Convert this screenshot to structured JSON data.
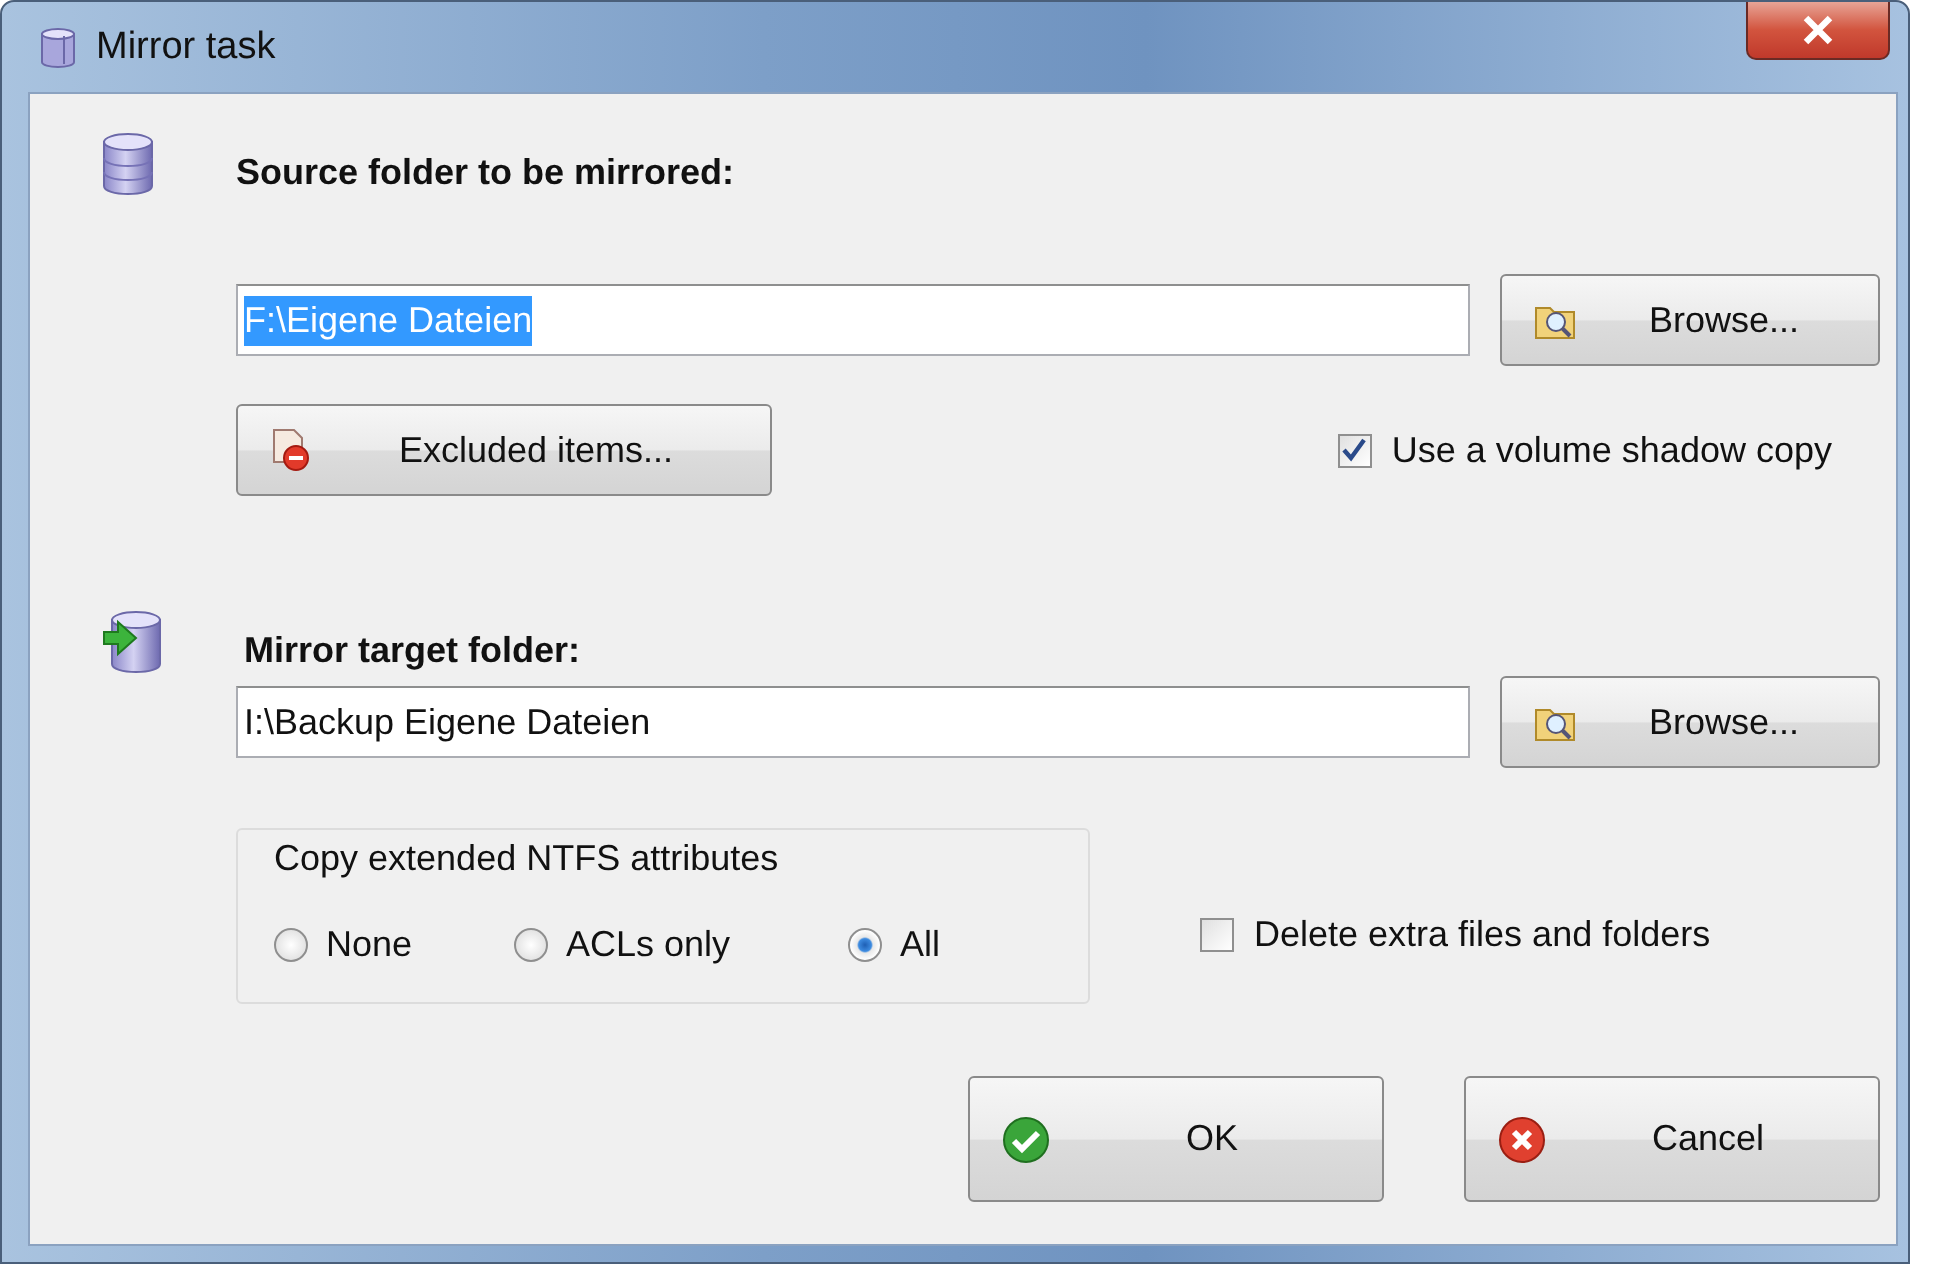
{
  "window": {
    "title": "Mirror task"
  },
  "source": {
    "label": "Source folder to be mirrored:",
    "path": "F:\\Eigene Dateien",
    "path_selected": true,
    "browse_button": "Browse...",
    "excluded_button": "Excluded items...",
    "shadow_copy": {
      "label": "Use a volume shadow copy",
      "checked": true
    }
  },
  "target": {
    "label": "Mirror target folder:",
    "path": "I:\\Backup Eigene Dateien",
    "browse_button": "Browse...",
    "ntfs_group": {
      "title": "Copy extended NTFS attributes",
      "options": [
        {
          "label": "None",
          "selected": false
        },
        {
          "label": "ACLs only",
          "selected": false
        },
        {
          "label": "All",
          "selected": true
        }
      ]
    },
    "delete_extra": {
      "label": "Delete extra files and folders",
      "checked": false
    }
  },
  "buttons": [
    {
      "kind": "ok",
      "label": "OK"
    },
    {
      "kind": "cancel",
      "label": "Cancel"
    }
  ]
}
